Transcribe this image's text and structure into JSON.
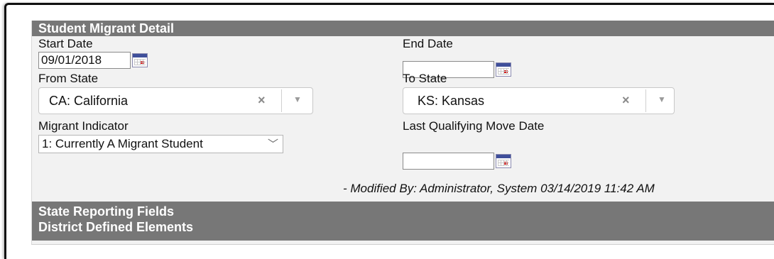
{
  "section_title": "Student Migrant Detail",
  "fields": {
    "start_date": {
      "label": "Start Date",
      "value": "09/01/2018"
    },
    "end_date": {
      "label": "End Date",
      "value": ""
    },
    "from_state": {
      "label": "From State",
      "value": "CA: California",
      "clear_icon": "×",
      "dropdown_icon": "▼"
    },
    "to_state": {
      "label": "To State",
      "value": "KS: Kansas",
      "clear_icon": "×",
      "dropdown_icon": "▼"
    },
    "migrant_indicator": {
      "label": "Migrant Indicator",
      "value": "1: Currently A Migrant Student",
      "chevron": "﹀"
    },
    "last_qualifying_move_date": {
      "label": "Last Qualifying Move Date",
      "value": ""
    }
  },
  "modified_by": "- Modified By: Administrator, System 03/14/2019 11:42 AM",
  "collapsed_sections": {
    "state_reporting": "State Reporting Fields",
    "district_defined": "District Defined Elements"
  },
  "colors": {
    "header_bg": "#777777",
    "panel_bg": "#f2f2f2",
    "calendar_header": "#3f4f9a",
    "calendar_marker": "#d21f1f"
  }
}
